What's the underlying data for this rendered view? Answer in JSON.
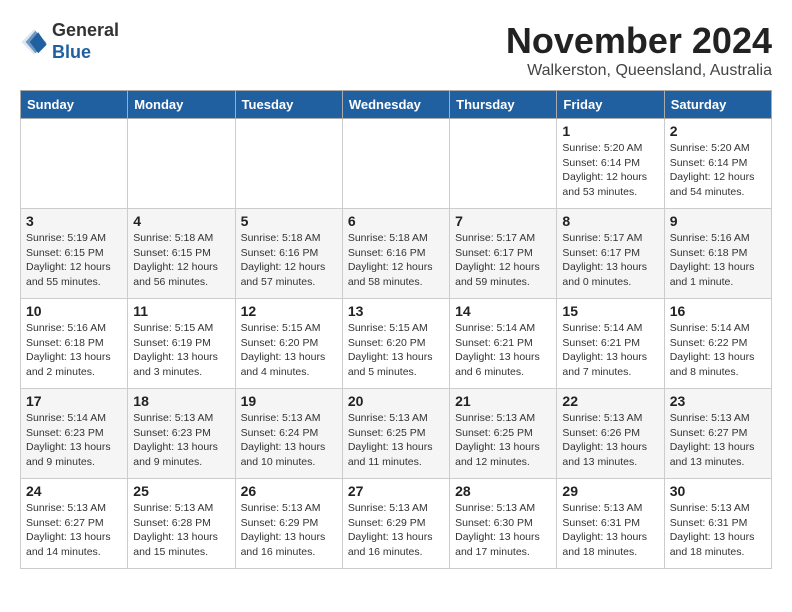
{
  "header": {
    "logo": {
      "general": "General",
      "blue": "Blue"
    },
    "title": "November 2024",
    "location": "Walkerston, Queensland, Australia"
  },
  "weekdays": [
    "Sunday",
    "Monday",
    "Tuesday",
    "Wednesday",
    "Thursday",
    "Friday",
    "Saturday"
  ],
  "weeks": [
    [
      {
        "day": "",
        "info": ""
      },
      {
        "day": "",
        "info": ""
      },
      {
        "day": "",
        "info": ""
      },
      {
        "day": "",
        "info": ""
      },
      {
        "day": "",
        "info": ""
      },
      {
        "day": "1",
        "info": "Sunrise: 5:20 AM\nSunset: 6:14 PM\nDaylight: 12 hours\nand 53 minutes."
      },
      {
        "day": "2",
        "info": "Sunrise: 5:20 AM\nSunset: 6:14 PM\nDaylight: 12 hours\nand 54 minutes."
      }
    ],
    [
      {
        "day": "3",
        "info": "Sunrise: 5:19 AM\nSunset: 6:15 PM\nDaylight: 12 hours\nand 55 minutes."
      },
      {
        "day": "4",
        "info": "Sunrise: 5:18 AM\nSunset: 6:15 PM\nDaylight: 12 hours\nand 56 minutes."
      },
      {
        "day": "5",
        "info": "Sunrise: 5:18 AM\nSunset: 6:16 PM\nDaylight: 12 hours\nand 57 minutes."
      },
      {
        "day": "6",
        "info": "Sunrise: 5:18 AM\nSunset: 6:16 PM\nDaylight: 12 hours\nand 58 minutes."
      },
      {
        "day": "7",
        "info": "Sunrise: 5:17 AM\nSunset: 6:17 PM\nDaylight: 12 hours\nand 59 minutes."
      },
      {
        "day": "8",
        "info": "Sunrise: 5:17 AM\nSunset: 6:17 PM\nDaylight: 13 hours\nand 0 minutes."
      },
      {
        "day": "9",
        "info": "Sunrise: 5:16 AM\nSunset: 6:18 PM\nDaylight: 13 hours\nand 1 minute."
      }
    ],
    [
      {
        "day": "10",
        "info": "Sunrise: 5:16 AM\nSunset: 6:18 PM\nDaylight: 13 hours\nand 2 minutes."
      },
      {
        "day": "11",
        "info": "Sunrise: 5:15 AM\nSunset: 6:19 PM\nDaylight: 13 hours\nand 3 minutes."
      },
      {
        "day": "12",
        "info": "Sunrise: 5:15 AM\nSunset: 6:20 PM\nDaylight: 13 hours\nand 4 minutes."
      },
      {
        "day": "13",
        "info": "Sunrise: 5:15 AM\nSunset: 6:20 PM\nDaylight: 13 hours\nand 5 minutes."
      },
      {
        "day": "14",
        "info": "Sunrise: 5:14 AM\nSunset: 6:21 PM\nDaylight: 13 hours\nand 6 minutes."
      },
      {
        "day": "15",
        "info": "Sunrise: 5:14 AM\nSunset: 6:21 PM\nDaylight: 13 hours\nand 7 minutes."
      },
      {
        "day": "16",
        "info": "Sunrise: 5:14 AM\nSunset: 6:22 PM\nDaylight: 13 hours\nand 8 minutes."
      }
    ],
    [
      {
        "day": "17",
        "info": "Sunrise: 5:14 AM\nSunset: 6:23 PM\nDaylight: 13 hours\nand 9 minutes."
      },
      {
        "day": "18",
        "info": "Sunrise: 5:13 AM\nSunset: 6:23 PM\nDaylight: 13 hours\nand 9 minutes."
      },
      {
        "day": "19",
        "info": "Sunrise: 5:13 AM\nSunset: 6:24 PM\nDaylight: 13 hours\nand 10 minutes."
      },
      {
        "day": "20",
        "info": "Sunrise: 5:13 AM\nSunset: 6:25 PM\nDaylight: 13 hours\nand 11 minutes."
      },
      {
        "day": "21",
        "info": "Sunrise: 5:13 AM\nSunset: 6:25 PM\nDaylight: 13 hours\nand 12 minutes."
      },
      {
        "day": "22",
        "info": "Sunrise: 5:13 AM\nSunset: 6:26 PM\nDaylight: 13 hours\nand 13 minutes."
      },
      {
        "day": "23",
        "info": "Sunrise: 5:13 AM\nSunset: 6:27 PM\nDaylight: 13 hours\nand 13 minutes."
      }
    ],
    [
      {
        "day": "24",
        "info": "Sunrise: 5:13 AM\nSunset: 6:27 PM\nDaylight: 13 hours\nand 14 minutes."
      },
      {
        "day": "25",
        "info": "Sunrise: 5:13 AM\nSunset: 6:28 PM\nDaylight: 13 hours\nand 15 minutes."
      },
      {
        "day": "26",
        "info": "Sunrise: 5:13 AM\nSunset: 6:29 PM\nDaylight: 13 hours\nand 16 minutes."
      },
      {
        "day": "27",
        "info": "Sunrise: 5:13 AM\nSunset: 6:29 PM\nDaylight: 13 hours\nand 16 minutes."
      },
      {
        "day": "28",
        "info": "Sunrise: 5:13 AM\nSunset: 6:30 PM\nDaylight: 13 hours\nand 17 minutes."
      },
      {
        "day": "29",
        "info": "Sunrise: 5:13 AM\nSunset: 6:31 PM\nDaylight: 13 hours\nand 18 minutes."
      },
      {
        "day": "30",
        "info": "Sunrise: 5:13 AM\nSunset: 6:31 PM\nDaylight: 13 hours\nand 18 minutes."
      }
    ]
  ]
}
